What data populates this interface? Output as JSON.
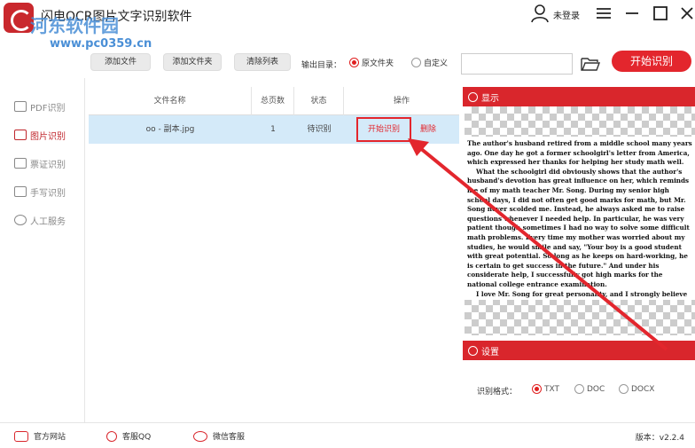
{
  "app": {
    "title": "闪电OCR图片文字识别软件",
    "watermark": "河东软件园",
    "watermark_url": "www.pc0359.cn",
    "login": "未登录"
  },
  "toolbar": {
    "add_file": "添加文件",
    "add_folder": "添加文件夹",
    "clear_list": "清除列表",
    "output_label": "输出目录：",
    "output_original": "原文件夹",
    "output_custom": "自定义",
    "path_value": "",
    "start_label": "开始识别"
  },
  "sidebar": {
    "items": [
      {
        "label": "PDF识别"
      },
      {
        "label": "图片识别"
      },
      {
        "label": "票证识别"
      },
      {
        "label": "手写识别"
      },
      {
        "label": "人工服务"
      }
    ]
  },
  "table": {
    "headers": [
      "文件名称",
      "总页数",
      "状态",
      "操作"
    ],
    "rows": [
      {
        "name": "oo - 副本.jpg",
        "pages": "1",
        "status": "待识别",
        "start": "开始识别",
        "delete": "删除"
      }
    ]
  },
  "preview": {
    "title": "显示",
    "paragraphs": [
      "The author's husband retired from a middle school many years ago. One day he got a former schoolgirl's letter from America, which expressed her thanks for helping her study math well.",
      "What the schoolgirl did obviously shows that the author's husband's devotion has great influence on her, which reminds me of my math teacher Mr. Song. During my senior high school days, I did not often get good marks for math, but Mr. Song never scolded me. Instead, he always asked me to raise questions whenever I needed help. In particular, he was very patient though sometimes I had no way to solve some difficult math problems. Every time my mother was worried about my studies, he would smile and say, \"Your boy is a good student with great potential. So long as he keeps on hard-working, he is certain to get success in the future.\" And under his considerate help, I successfully got high marks for the national college entrance examination.",
      "I love Mr. Song for great personality, and I strongly believe that what teachers show to us students can affect our wonderful future greatly."
    ]
  },
  "settings": {
    "title": "设置",
    "format_label": "识别格式：",
    "formats": [
      "TXT",
      "DOC",
      "DOCX"
    ],
    "selected": "TXT"
  },
  "bottom": {
    "website": "官方网站",
    "qq": "客服QQ",
    "wechat": "微信客服",
    "version": "版本：v2.2.4"
  },
  "colors": {
    "accent": "#e3262d",
    "row_highlight": "#d4eaf9"
  }
}
